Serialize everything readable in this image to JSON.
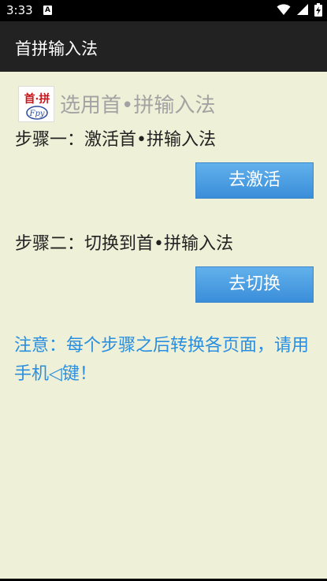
{
  "status_bar": {
    "time": "3:33",
    "notification_badge": "A",
    "icons": [
      "wifi-icon",
      "signal-icon",
      "battery-charging-icon"
    ]
  },
  "app_bar": {
    "title": "首拼输入法"
  },
  "logo": {
    "top_text": "首·拼",
    "bottom_text": "Fpy"
  },
  "main": {
    "heading": "选用首•拼输入法",
    "step1": {
      "label": "步骤一：激活首•拼输入法",
      "button": "去激活"
    },
    "step2": {
      "label": "步骤二：切换到首•拼输入法",
      "button": "去切换"
    },
    "note": "注意：每个步骤之后转换各页面，请用手机◁键！"
  },
  "colors": {
    "background": "#eef1d7",
    "app_bar": "#222222",
    "button": "#4a9fe3",
    "note_text": "#2a8ee0",
    "heading_text": "#a3a3a3"
  }
}
